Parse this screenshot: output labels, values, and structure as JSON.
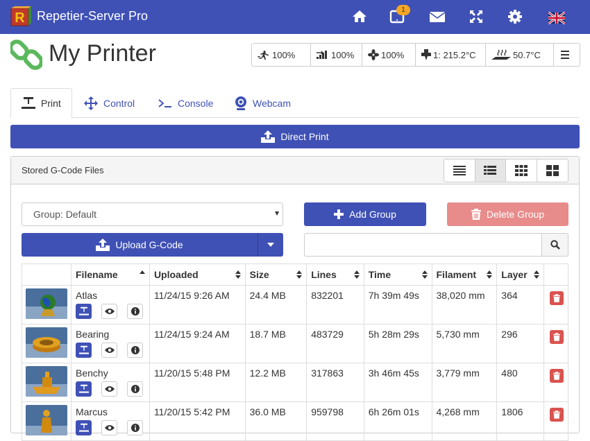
{
  "app": {
    "title": "Repetier-Server Pro",
    "notification_count": "1"
  },
  "header": {
    "title": "My Printer"
  },
  "status": {
    "speed": "100%",
    "flow": "100%",
    "fan": "100%",
    "extruder": "1: 215.2°C",
    "bed": "50.7°C"
  },
  "tabs": [
    {
      "label": "Print"
    },
    {
      "label": "Control"
    },
    {
      "label": "Console"
    },
    {
      "label": "Webcam"
    }
  ],
  "direct_print_label": "Direct Print",
  "panel": {
    "title": "Stored G-Code Files"
  },
  "group_select": {
    "value": "Group: Default"
  },
  "add_group_label": "Add Group",
  "delete_group_label": "Delete Group",
  "upload_label": "Upload G-Code",
  "search": {
    "value": "",
    "placeholder": ""
  },
  "table": {
    "columns": [
      "Filename",
      "Uploaded",
      "Size",
      "Lines",
      "Time",
      "Filament",
      "Layer"
    ],
    "rows": [
      {
        "filename": "Atlas",
        "uploaded": "11/24/15 9:26 AM",
        "size": "24.4 MB",
        "lines": "832201",
        "time": "7h 39m 49s",
        "filament": "38,020 mm",
        "layer": "364"
      },
      {
        "filename": "Bearing",
        "uploaded": "11/24/15 9:24 AM",
        "size": "18.7 MB",
        "lines": "483729",
        "time": "5h 28m 29s",
        "filament": "5,730 mm",
        "layer": "296"
      },
      {
        "filename": "Benchy",
        "uploaded": "11/20/15 5:48 PM",
        "size": "12.2 MB",
        "lines": "317863",
        "time": "3h 46m 45s",
        "filament": "3,779 mm",
        "layer": "480"
      },
      {
        "filename": "Marcus",
        "uploaded": "11/20/15 5:42 PM",
        "size": "36.0 MB",
        "lines": "959798",
        "time": "6h 26m 01s",
        "filament": "4,268 mm",
        "layer": "1806"
      }
    ]
  },
  "colors": {
    "primary": "#3f51b5",
    "danger": "#d9534f",
    "danger_light": "#e88b8b",
    "badge": "#f5a623"
  }
}
